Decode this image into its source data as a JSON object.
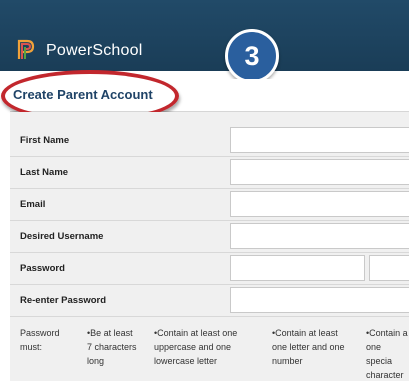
{
  "header": {
    "brand": "PowerSchool",
    "step_number": "3"
  },
  "page": {
    "title": "Create Parent Account"
  },
  "form": {
    "first_name_label": "First Name",
    "last_name_label": "Last Name",
    "email_label": "Email",
    "username_label": "Desired Username",
    "password_label": "Password",
    "reenter_password_label": "Re-enter Password"
  },
  "requirements": {
    "intro_line1": "Password",
    "intro_line2": "must:",
    "rule1_line1": "•Be at least",
    "rule1_line2": "7 characters",
    "rule1_line3": "long",
    "rule2_line1": "•Contain at least one",
    "rule2_line2": "uppercase and one",
    "rule2_line3": "lowercase letter",
    "rule3_line1": "•Contain at least",
    "rule3_line2": "one letter and one",
    "rule3_line3": "number",
    "rule4_line1": "•Contain a",
    "rule4_line2": "one specia",
    "rule4_line3": "character"
  },
  "colors": {
    "header_bg": "#1a3d57",
    "title_text": "#1f4367",
    "badge_bg": "#2a5f9e",
    "highlight_oval": "#c2272d"
  }
}
